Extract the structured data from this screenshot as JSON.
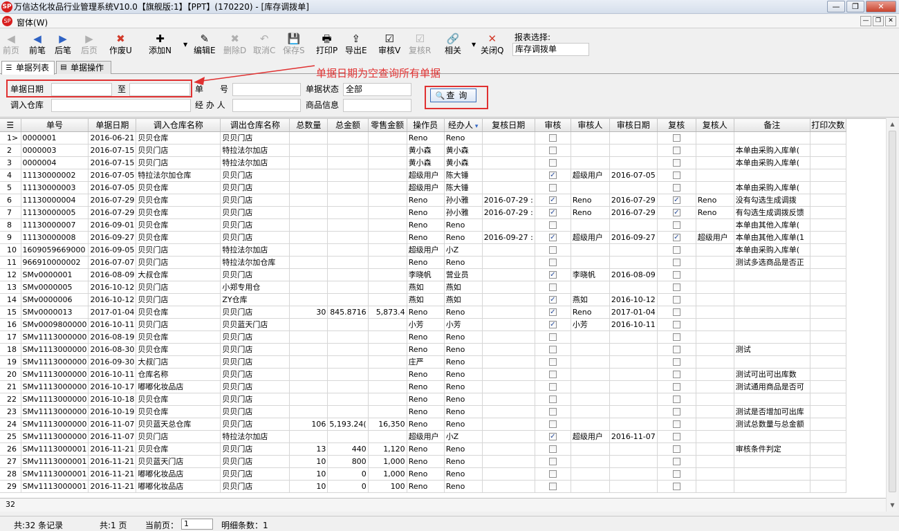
{
  "window": {
    "title": "万信达化妆品行业管理系统V10.0【旗舰版:1】【PPT】(170220) - [库存调拨单]",
    "logo": "SP",
    "min": "—",
    "max": "❐",
    "close": "✕"
  },
  "menubar": {
    "logo": "SP",
    "menu": "窗体(W)",
    "btn_min": "—",
    "btn_restore": "❐",
    "btn_close": "✕"
  },
  "toolbar": {
    "buttons": [
      {
        "label": "前页",
        "icon": "◀",
        "enabled": false
      },
      {
        "label": "前笔",
        "icon": "◀",
        "enabled": true
      },
      {
        "label": "后笔",
        "icon": "▶",
        "enabled": true
      },
      {
        "label": "后页",
        "icon": "▶",
        "enabled": false
      },
      {
        "label": "作废U",
        "icon": "✖",
        "enabled": true
      },
      {
        "label": "添加N",
        "icon": "✚",
        "enabled": true
      },
      {
        "label": "编辑E",
        "icon": "✎",
        "enabled": true
      },
      {
        "label": "删除D",
        "icon": "✖",
        "enabled": false
      },
      {
        "label": "取消C",
        "icon": "↶",
        "enabled": false
      },
      {
        "label": "保存S",
        "icon": "💾",
        "enabled": false
      },
      {
        "label": "打印P",
        "icon": "🖶",
        "enabled": true
      },
      {
        "label": "导出E",
        "icon": "⇪",
        "enabled": true
      },
      {
        "label": "审核V",
        "icon": "☑",
        "enabled": true
      },
      {
        "label": "复核R",
        "icon": "☑",
        "enabled": false
      },
      {
        "label": "相关",
        "icon": "🔗",
        "enabled": true
      },
      {
        "label": "关闭Q",
        "icon": "✕",
        "enabled": true
      }
    ],
    "report_select_label": "报表选择:",
    "report_select_value": "库存调拨单"
  },
  "tabs": [
    {
      "label": "单据列表",
      "icon": "☰",
      "active": true
    },
    {
      "label": "单据操作",
      "icon": "▤",
      "active": false
    }
  ],
  "filter": {
    "date_label": "单据日期",
    "date_to": "至",
    "date_from_value": "",
    "date_to_value": "",
    "in_wh_label": "调入仓库",
    "in_wh_value": "",
    "doc_no_label": "单　　号",
    "doc_no_value": "",
    "handler_label": "经 办 人",
    "handler_value": "",
    "status_label": "单据状态",
    "status_value": "全部",
    "goods_label": "商品信息",
    "goods_value": "",
    "query_button": "查询",
    "query_icon": "🔍"
  },
  "annotation": {
    "text": "单据日期为空查询所有单据",
    "color": "#e03030"
  },
  "grid": {
    "columns": [
      "",
      "单号",
      "单据日期",
      "调入仓库名称",
      "调出仓库名称",
      "总数量",
      "总金额",
      "零售金额",
      "操作员",
      "经办人",
      "复核日期",
      "审核",
      "审核人",
      "审核日期",
      "复核",
      "复核人",
      "备注",
      "打印次数"
    ],
    "rows": [
      [
        "1>",
        "0000001",
        "2016-06-21",
        "贝贝仓库",
        "贝贝门店",
        "",
        "",
        "",
        "Reno",
        "Reno",
        "",
        false,
        "",
        "",
        false,
        "",
        "",
        ""
      ],
      [
        "2",
        "0000003",
        "2016-07-15",
        "贝贝门店",
        "特拉法尔加店",
        "",
        "",
        "",
        "黄小森",
        "黄小森",
        "",
        false,
        "",
        "",
        false,
        "",
        "本单由采购入库单(",
        ""
      ],
      [
        "3",
        "0000004",
        "2016-07-15",
        "贝贝门店",
        "特拉法尔加店",
        "",
        "",
        "",
        "黄小森",
        "黄小森",
        "",
        false,
        "",
        "",
        false,
        "",
        "本单由采购入库单(",
        ""
      ],
      [
        "4",
        "11130000002",
        "2016-07-05",
        "特拉法尔加仓库",
        "贝贝门店",
        "",
        "",
        "",
        "超级用户",
        "陈大锤",
        "",
        true,
        "超级用户",
        "2016-07-05",
        false,
        "",
        "",
        ""
      ],
      [
        "5",
        "11130000003",
        "2016-07-05",
        "贝贝仓库",
        "贝贝门店",
        "",
        "",
        "",
        "超级用户",
        "陈大锤",
        "",
        false,
        "",
        "",
        false,
        "",
        "本单由采购入库单(",
        ""
      ],
      [
        "6",
        "11130000004",
        "2016-07-29",
        "贝贝仓库",
        "贝贝门店",
        "",
        "",
        "",
        "Reno",
        "孙小雅",
        "2016-07-29 :",
        true,
        "Reno",
        "2016-07-29",
        true,
        "Reno",
        "没有勾选生成调拨",
        ""
      ],
      [
        "7",
        "11130000005",
        "2016-07-29",
        "贝贝仓库",
        "贝贝门店",
        "",
        "",
        "",
        "Reno",
        "孙小雅",
        "2016-07-29 :",
        true,
        "Reno",
        "2016-07-29",
        true,
        "Reno",
        "有勾选生成调拨反馈",
        ""
      ],
      [
        "8",
        "11130000007",
        "2016-09-01",
        "贝贝仓库",
        "贝贝门店",
        "",
        "",
        "",
        "Reno",
        "Reno",
        "",
        false,
        "",
        "",
        false,
        "",
        "本单由其他入库单(",
        ""
      ],
      [
        "9",
        "11130000008",
        "2016-09-27",
        "贝贝仓库",
        "贝贝门店",
        "",
        "",
        "",
        "Reno",
        "Reno",
        "2016-09-27 :",
        true,
        "超级用户",
        "2016-09-27",
        true,
        "超级用户",
        "本单由其他入库单(1",
        ""
      ],
      [
        "10",
        "1609059669000",
        "2016-09-05",
        "贝贝门店",
        "特拉法尔加店",
        "",
        "",
        "",
        "超级用户",
        "小Z",
        "",
        false,
        "",
        "",
        false,
        "",
        "本单由采购入库单(",
        ""
      ],
      [
        "11",
        "966910000002",
        "2016-07-07",
        "贝贝门店",
        "特拉法尔加仓库",
        "",
        "",
        "",
        "Reno",
        "Reno",
        "",
        false,
        "",
        "",
        false,
        "",
        "测试多选商品是否正",
        ""
      ],
      [
        "12",
        "SMv0000001",
        "2016-08-09",
        "大叔仓库",
        "贝贝门店",
        "",
        "",
        "",
        "李晓帆",
        "营业员",
        "",
        true,
        "李晓帆",
        "2016-08-09",
        false,
        "",
        "",
        ""
      ],
      [
        "13",
        "SMv0000005",
        "2016-10-12",
        "贝贝门店",
        "小郑专用仓",
        "",
        "",
        "",
        "燕如",
        "燕如",
        "",
        false,
        "",
        "",
        false,
        "",
        "",
        ""
      ],
      [
        "14",
        "SMv0000006",
        "2016-10-12",
        "贝贝门店",
        "ZY仓库",
        "",
        "",
        "",
        "燕如",
        "燕如",
        "",
        true,
        "燕如",
        "2016-10-12",
        false,
        "",
        "",
        ""
      ],
      [
        "15",
        "SMv0000013",
        "2017-01-04",
        "贝贝仓库",
        "贝贝门店",
        "30",
        "845.8716",
        "5,873.4",
        "Reno",
        "Reno",
        "",
        true,
        "Reno",
        "2017-01-04",
        false,
        "",
        "",
        ""
      ],
      [
        "16",
        "SMv0009800000",
        "2016-10-11",
        "贝贝门店",
        "贝贝蓝天门店",
        "",
        "",
        "",
        "小芳",
        "小芳",
        "",
        true,
        "小芳",
        "2016-10-11",
        false,
        "",
        "",
        ""
      ],
      [
        "17",
        "SMv1113000000",
        "2016-08-19",
        "贝贝仓库",
        "贝贝门店",
        "",
        "",
        "",
        "Reno",
        "Reno",
        "",
        false,
        "",
        "",
        false,
        "",
        "",
        ""
      ],
      [
        "18",
        "SMv1113000000",
        "2016-08-30",
        "贝贝仓库",
        "贝贝门店",
        "",
        "",
        "",
        "Reno",
        "Reno",
        "",
        false,
        "",
        "",
        false,
        "",
        "测试",
        ""
      ],
      [
        "19",
        "SMv1113000000",
        "2016-09-30",
        "大叔门店",
        "贝贝门店",
        "",
        "",
        "",
        "庄严",
        "Reno",
        "",
        false,
        "",
        "",
        false,
        "",
        "",
        ""
      ],
      [
        "20",
        "SMv1113000000",
        "2016-10-11",
        "仓库名称",
        "贝贝门店",
        "",
        "",
        "",
        "Reno",
        "Reno",
        "",
        false,
        "",
        "",
        false,
        "",
        "测试可出可出库数",
        ""
      ],
      [
        "21",
        "SMv1113000000",
        "2016-10-17",
        "嘟嘟化妆品店",
        "贝贝门店",
        "",
        "",
        "",
        "Reno",
        "Reno",
        "",
        false,
        "",
        "",
        false,
        "",
        "测试通用商品是否可",
        ""
      ],
      [
        "22",
        "SMv1113000000",
        "2016-10-18",
        "贝贝仓库",
        "贝贝门店",
        "",
        "",
        "",
        "Reno",
        "Reno",
        "",
        false,
        "",
        "",
        false,
        "",
        "",
        ""
      ],
      [
        "23",
        "SMv1113000000",
        "2016-10-19",
        "贝贝仓库",
        "贝贝门店",
        "",
        "",
        "",
        "Reno",
        "Reno",
        "",
        false,
        "",
        "",
        false,
        "",
        "测试是否增加可出库",
        ""
      ],
      [
        "24",
        "SMv1113000000",
        "2016-11-07",
        "贝贝蓝天总仓库",
        "贝贝门店",
        "106",
        "5,193.24(",
        "16,350",
        "Reno",
        "Reno",
        "",
        false,
        "",
        "",
        false,
        "",
        "测试总数量与总金额",
        ""
      ],
      [
        "25",
        "SMv1113000000",
        "2016-11-07",
        "贝贝门店",
        "特拉法尔加店",
        "",
        "",
        "",
        "超级用户",
        "小Z",
        "",
        true,
        "超级用户",
        "2016-11-07",
        false,
        "",
        "",
        ""
      ],
      [
        "26",
        "SMv1113000001",
        "2016-11-21",
        "贝贝仓库",
        "贝贝门店",
        "13",
        "440",
        "1,120",
        "Reno",
        "Reno",
        "",
        false,
        "",
        "",
        false,
        "",
        "审核条件判定",
        ""
      ],
      [
        "27",
        "SMv1113000001",
        "2016-11-21",
        "贝贝蓝天门店",
        "贝贝门店",
        "10",
        "800",
        "1,000",
        "Reno",
        "Reno",
        "",
        false,
        "",
        "",
        false,
        "",
        "",
        ""
      ],
      [
        "28",
        "SMv1113000001",
        "2016-11-21",
        "嘟嘟化妆品店",
        "贝贝门店",
        "10",
        "0",
        "1,000",
        "Reno",
        "Reno",
        "",
        false,
        "",
        "",
        false,
        "",
        "",
        ""
      ],
      [
        "29",
        "SMv1113000001",
        "2016-11-21",
        "嘟嘟化妆品店",
        "贝贝门店",
        "10",
        "0",
        "100",
        "Reno",
        "Reno",
        "",
        false,
        "",
        "",
        false,
        "",
        "",
        ""
      ]
    ],
    "footer_count": "32"
  },
  "statusbar": {
    "records": "共:32 条记录",
    "pages": "共:1 页",
    "current_page_label": "当前页：",
    "current_page_value": "1",
    "detail_count": "明细条数：1"
  }
}
